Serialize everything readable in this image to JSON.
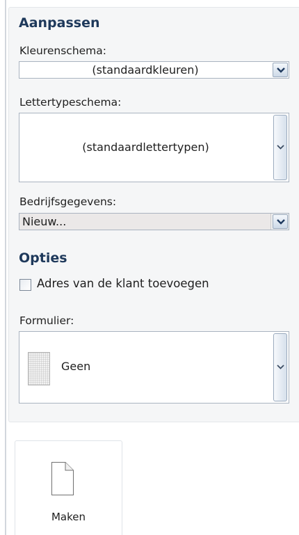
{
  "customize": {
    "heading": "Aanpassen",
    "color_scheme": {
      "label": "Kleurenschema:",
      "value": "(standaardkleuren)"
    },
    "font_scheme": {
      "label": "Lettertypeschema:",
      "value": "(standaardlettertypen)"
    },
    "business_info": {
      "label": "Bedrijfsgegevens:",
      "value": "Nieuw..."
    }
  },
  "options": {
    "heading": "Opties",
    "add_customer_address": {
      "label": "Adres van de klant toevoegen",
      "checked": false
    },
    "form": {
      "label": "Formulier:",
      "value": "Geen"
    }
  },
  "create_button": {
    "label": "Maken",
    "icon": "blank-document-icon"
  },
  "colors": {
    "heading": "#1e395b",
    "panel_bg": "#f5f6f7",
    "border": "#a9b3c0"
  }
}
